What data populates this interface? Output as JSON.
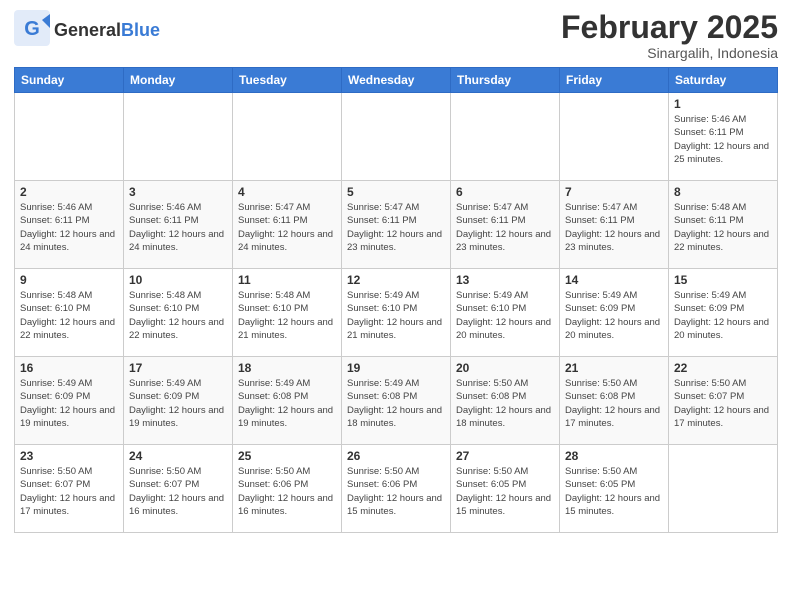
{
  "header": {
    "logo_general": "General",
    "logo_blue": "Blue",
    "month_title": "February 2025",
    "location": "Sinargalih, Indonesia"
  },
  "days_of_week": [
    "Sunday",
    "Monday",
    "Tuesday",
    "Wednesday",
    "Thursday",
    "Friday",
    "Saturday"
  ],
  "weeks": [
    [
      {
        "day": "",
        "info": ""
      },
      {
        "day": "",
        "info": ""
      },
      {
        "day": "",
        "info": ""
      },
      {
        "day": "",
        "info": ""
      },
      {
        "day": "",
        "info": ""
      },
      {
        "day": "",
        "info": ""
      },
      {
        "day": "1",
        "info": "Sunrise: 5:46 AM\nSunset: 6:11 PM\nDaylight: 12 hours\nand 25 minutes."
      }
    ],
    [
      {
        "day": "2",
        "info": "Sunrise: 5:46 AM\nSunset: 6:11 PM\nDaylight: 12 hours\nand 24 minutes."
      },
      {
        "day": "3",
        "info": "Sunrise: 5:46 AM\nSunset: 6:11 PM\nDaylight: 12 hours\nand 24 minutes."
      },
      {
        "day": "4",
        "info": "Sunrise: 5:47 AM\nSunset: 6:11 PM\nDaylight: 12 hours\nand 24 minutes."
      },
      {
        "day": "5",
        "info": "Sunrise: 5:47 AM\nSunset: 6:11 PM\nDaylight: 12 hours\nand 23 minutes."
      },
      {
        "day": "6",
        "info": "Sunrise: 5:47 AM\nSunset: 6:11 PM\nDaylight: 12 hours\nand 23 minutes."
      },
      {
        "day": "7",
        "info": "Sunrise: 5:47 AM\nSunset: 6:11 PM\nDaylight: 12 hours\nand 23 minutes."
      },
      {
        "day": "8",
        "info": "Sunrise: 5:48 AM\nSunset: 6:11 PM\nDaylight: 12 hours\nand 22 minutes."
      }
    ],
    [
      {
        "day": "9",
        "info": "Sunrise: 5:48 AM\nSunset: 6:10 PM\nDaylight: 12 hours\nand 22 minutes."
      },
      {
        "day": "10",
        "info": "Sunrise: 5:48 AM\nSunset: 6:10 PM\nDaylight: 12 hours\nand 22 minutes."
      },
      {
        "day": "11",
        "info": "Sunrise: 5:48 AM\nSunset: 6:10 PM\nDaylight: 12 hours\nand 21 minutes."
      },
      {
        "day": "12",
        "info": "Sunrise: 5:49 AM\nSunset: 6:10 PM\nDaylight: 12 hours\nand 21 minutes."
      },
      {
        "day": "13",
        "info": "Sunrise: 5:49 AM\nSunset: 6:10 PM\nDaylight: 12 hours\nand 20 minutes."
      },
      {
        "day": "14",
        "info": "Sunrise: 5:49 AM\nSunset: 6:09 PM\nDaylight: 12 hours\nand 20 minutes."
      },
      {
        "day": "15",
        "info": "Sunrise: 5:49 AM\nSunset: 6:09 PM\nDaylight: 12 hours\nand 20 minutes."
      }
    ],
    [
      {
        "day": "16",
        "info": "Sunrise: 5:49 AM\nSunset: 6:09 PM\nDaylight: 12 hours\nand 19 minutes."
      },
      {
        "day": "17",
        "info": "Sunrise: 5:49 AM\nSunset: 6:09 PM\nDaylight: 12 hours\nand 19 minutes."
      },
      {
        "day": "18",
        "info": "Sunrise: 5:49 AM\nSunset: 6:08 PM\nDaylight: 12 hours\nand 19 minutes."
      },
      {
        "day": "19",
        "info": "Sunrise: 5:49 AM\nSunset: 6:08 PM\nDaylight: 12 hours\nand 18 minutes."
      },
      {
        "day": "20",
        "info": "Sunrise: 5:50 AM\nSunset: 6:08 PM\nDaylight: 12 hours\nand 18 minutes."
      },
      {
        "day": "21",
        "info": "Sunrise: 5:50 AM\nSunset: 6:08 PM\nDaylight: 12 hours\nand 17 minutes."
      },
      {
        "day": "22",
        "info": "Sunrise: 5:50 AM\nSunset: 6:07 PM\nDaylight: 12 hours\nand 17 minutes."
      }
    ],
    [
      {
        "day": "23",
        "info": "Sunrise: 5:50 AM\nSunset: 6:07 PM\nDaylight: 12 hours\nand 17 minutes."
      },
      {
        "day": "24",
        "info": "Sunrise: 5:50 AM\nSunset: 6:07 PM\nDaylight: 12 hours\nand 16 minutes."
      },
      {
        "day": "25",
        "info": "Sunrise: 5:50 AM\nSunset: 6:06 PM\nDaylight: 12 hours\nand 16 minutes."
      },
      {
        "day": "26",
        "info": "Sunrise: 5:50 AM\nSunset: 6:06 PM\nDaylight: 12 hours\nand 15 minutes."
      },
      {
        "day": "27",
        "info": "Sunrise: 5:50 AM\nSunset: 6:05 PM\nDaylight: 12 hours\nand 15 minutes."
      },
      {
        "day": "28",
        "info": "Sunrise: 5:50 AM\nSunset: 6:05 PM\nDaylight: 12 hours\nand 15 minutes."
      },
      {
        "day": "",
        "info": ""
      }
    ]
  ]
}
